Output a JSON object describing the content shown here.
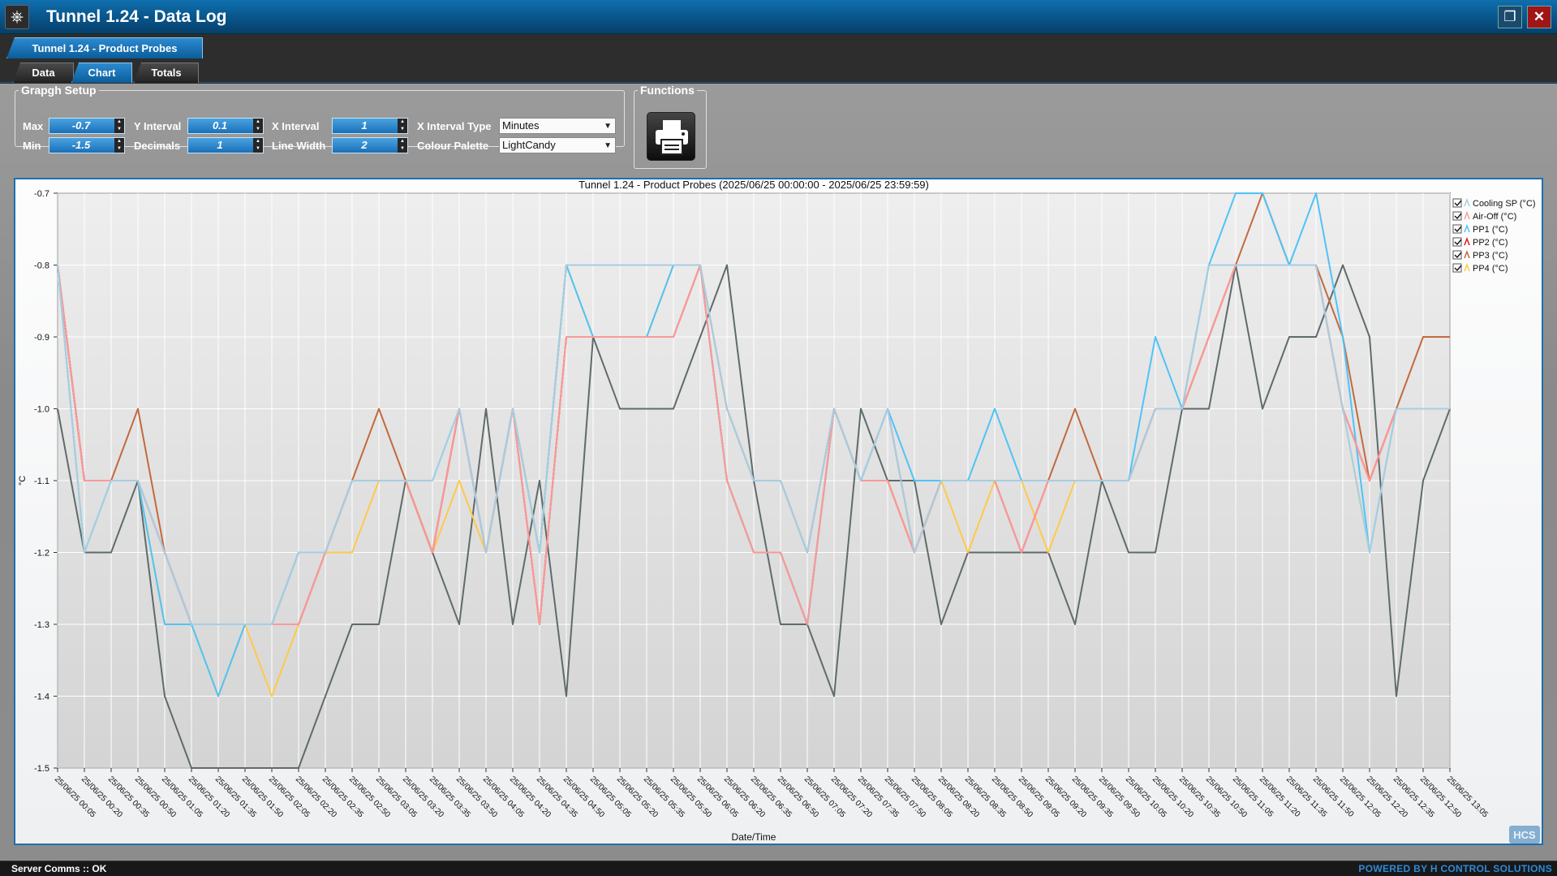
{
  "window": {
    "title": "Tunnel 1.24 - Data Log"
  },
  "top_tab": {
    "label": "Tunnel 1.24 - Product Probes"
  },
  "sub_tabs": [
    {
      "label": "Data"
    },
    {
      "label": "Chart"
    },
    {
      "label": "Totals"
    }
  ],
  "graph_setup": {
    "legend": "Grapgh Setup",
    "max_label": "Max",
    "max_value": "-0.7",
    "min_label": "Min",
    "min_value": "-1.5",
    "y_interval_label": "Y Interval",
    "y_interval_value": "0.1",
    "decimals_label": "Decimals",
    "decimals_value": "1",
    "x_interval_label": "X Interval",
    "x_interval_value": "1",
    "line_width_label": "Line Width",
    "line_width_value": "2",
    "x_interval_type_label": "X Interval Type",
    "x_interval_type_value": "Minutes",
    "colour_palette_label": "Colour Palette",
    "colour_palette_value": "LightCandy"
  },
  "functions": {
    "legend": "Functions",
    "print_icon": "printer-icon"
  },
  "status": {
    "text": "Server Comms :: OK",
    "powered": "POWERED BY H CONTROL SOLUTIONS"
  },
  "logo": {
    "text": "HCS"
  },
  "chart_data": {
    "type": "line",
    "title": "Tunnel 1.24 - Product Probes (2025/06/25 00:00:00 - 2025/06/25 23:59:59)",
    "xlabel": "Date/Time",
    "ylabel": "°C",
    "ylim": [
      -1.5,
      -0.7
    ],
    "yticks": [
      "-0.7",
      "-0.8",
      "-0.9",
      "-1.0",
      "-1.1",
      "-1.2",
      "-1.3",
      "-1.4",
      "-1.5"
    ],
    "grid": true,
    "legend_position": "top-right",
    "categories": [
      "25/06/25 00:05",
      "25/06/25 00:20",
      "25/06/25 00:35",
      "25/06/25 00:50",
      "25/06/25 01:05",
      "25/06/25 01:20",
      "25/06/25 01:35",
      "25/06/25 01:50",
      "25/06/25 02:05",
      "25/06/25 02:20",
      "25/06/25 02:35",
      "25/06/25 02:50",
      "25/06/25 03:05",
      "25/06/25 03:20",
      "25/06/25 03:35",
      "25/06/25 03:50",
      "25/06/25 04:05",
      "25/06/25 04:20",
      "25/06/25 04:35",
      "25/06/25 04:50",
      "25/06/25 05:05",
      "25/06/25 05:20",
      "25/06/25 05:35",
      "25/06/25 05:50",
      "25/06/25 06:05",
      "25/06/25 06:20",
      "25/06/25 06:35",
      "25/06/25 06:50",
      "25/06/25 07:05",
      "25/06/25 07:20",
      "25/06/25 07:35",
      "25/06/25 07:50",
      "25/06/25 08:05",
      "25/06/25 08:20",
      "25/06/25 08:35",
      "25/06/25 08:50",
      "25/06/25 09:05",
      "25/06/25 09:20",
      "25/06/25 09:35",
      "25/06/25 09:50",
      "25/06/25 10:05",
      "25/06/25 10:20",
      "25/06/25 10:35",
      "25/06/25 10:50",
      "25/06/25 11:05",
      "25/06/25 11:20",
      "25/06/25 11:35",
      "25/06/25 11:50",
      "25/06/25 12:05",
      "25/06/25 12:20",
      "25/06/25 12:35",
      "25/06/25 12:50",
      "25/06/25 13:05"
    ],
    "series": [
      {
        "name": "Cooling SP (°C)",
        "color": "#a6cee3",
        "values": [
          -0.8,
          -1.2,
          -1.1,
          -1.1,
          -1.2,
          -1.3,
          -1.3,
          -1.3,
          -1.3,
          -1.2,
          -1.2,
          -1.1,
          -1.1,
          -1.1,
          -1.1,
          -1.0,
          -1.2,
          -1.0,
          -1.2,
          -0.8,
          -0.8,
          -0.8,
          -0.8,
          -0.8,
          -0.8,
          -1.0,
          -1.1,
          -1.1,
          -1.2,
          -1.0,
          -1.1,
          -1.0,
          -1.2,
          -1.1,
          -1.1,
          -1.1,
          -1.1,
          -1.1,
          -1.1,
          -1.1,
          -1.1,
          -1.0,
          -1.0,
          -0.8,
          -0.8,
          -0.8,
          -0.8,
          -0.8,
          -1.0,
          -1.2,
          -1.0,
          -1.0,
          -1.0
        ]
      },
      {
        "name": "Air-Off (°C)",
        "color": "#fb9a99",
        "values": [
          -0.8,
          -1.1,
          -1.1,
          -1.1,
          -1.2,
          -1.3,
          -1.3,
          -1.3,
          -1.3,
          -1.3,
          -1.2,
          -1.1,
          -1.1,
          -1.1,
          -1.2,
          -1.0,
          -1.2,
          -1.0,
          -1.3,
          -0.9,
          -0.9,
          -0.9,
          -0.9,
          -0.9,
          -0.8,
          -1.1,
          -1.2,
          -1.2,
          -1.3,
          -1.0,
          -1.1,
          -1.1,
          -1.2,
          -1.1,
          -1.1,
          -1.1,
          -1.2,
          -1.1,
          -1.1,
          -1.1,
          -1.1,
          -1.0,
          -1.0,
          -0.9,
          -0.8,
          -0.8,
          -0.8,
          -0.8,
          -1.0,
          -1.1,
          -1.0,
          -1.0,
          -1.0
        ]
      },
      {
        "name": "PP1 (°C)",
        "color": "#4fc3f7",
        "values": [
          -0.8,
          -1.2,
          -1.1,
          -1.1,
          -1.3,
          -1.3,
          -1.4,
          -1.3,
          -1.3,
          -1.2,
          -1.2,
          -1.1,
          -1.1,
          -1.1,
          -1.1,
          -1.0,
          -1.2,
          -1.0,
          -1.2,
          -0.8,
          -0.9,
          -0.9,
          -0.9,
          -0.8,
          -0.8,
          -1.1,
          -1.2,
          -1.2,
          -1.3,
          -1.0,
          -1.1,
          -1.0,
          -1.1,
          -1.1,
          -1.1,
          -1.0,
          -1.1,
          -1.1,
          -1.1,
          -1.1,
          -1.1,
          -0.9,
          -1.0,
          -0.8,
          -0.7,
          -0.7,
          -0.8,
          -0.7,
          -0.9,
          -1.2,
          -1.0,
          -1.0,
          -1.0
        ]
      },
      {
        "name": "PP2 (°C)",
        "color": "#e31a1c",
        "values": [
          -0.8,
          -1.1,
          -1.1,
          -1.1,
          -1.2,
          -1.3,
          -1.3,
          -1.3,
          -1.3,
          -1.3,
          -1.2,
          -1.1,
          -1.1,
          -1.1,
          -1.2,
          -1.0,
          -1.2,
          -1.0,
          -1.3,
          -0.9,
          -0.9,
          -0.9,
          -0.9,
          -0.9,
          -0.8,
          -1.1,
          -1.2,
          -1.2,
          -1.3,
          -1.0,
          -1.1,
          -1.1,
          -1.2,
          -1.1,
          -1.1,
          -1.1,
          -1.2,
          -1.1,
          -1.1,
          -1.1,
          -1.1,
          -1.0,
          -1.0,
          -0.9,
          -0.8,
          -0.8,
          -0.8,
          -0.8,
          -1.0,
          -1.1,
          -1.0,
          -1.0,
          -1.0
        ]
      },
      {
        "name": "PP3 (°C)",
        "color": "#c26a3d",
        "values": [
          -0.8,
          -1.1,
          -1.1,
          -1.0,
          -1.2,
          -1.3,
          -1.3,
          -1.3,
          -1.3,
          -1.2,
          -1.2,
          -1.1,
          -1.0,
          -1.1,
          -1.2,
          -1.0,
          -1.2,
          -1.0,
          -1.2,
          -0.8,
          -0.8,
          -0.8,
          -0.8,
          -0.8,
          -0.8,
          -1.0,
          -1.1,
          -1.1,
          -1.2,
          -1.0,
          -1.1,
          -1.0,
          -1.2,
          -1.1,
          -1.1,
          -1.1,
          -1.1,
          -1.1,
          -1.0,
          -1.1,
          -1.1,
          -1.0,
          -1.0,
          -0.8,
          -0.8,
          -0.7,
          -0.8,
          -0.8,
          -0.9,
          -1.1,
          -1.0,
          -0.9,
          -0.9
        ]
      },
      {
        "name": "PP4 (°C)",
        "color": "#ffc94a",
        "values": [
          -0.8,
          -1.2,
          -1.1,
          -1.1,
          -1.3,
          -1.3,
          -1.4,
          -1.3,
          -1.4,
          -1.3,
          -1.2,
          -1.2,
          -1.1,
          -1.1,
          -1.2,
          -1.1,
          -1.2,
          -1.0,
          -1.2,
          -0.8,
          -0.9,
          -0.9,
          -0.9,
          -0.8,
          -0.8,
          -1.1,
          -1.2,
          -1.2,
          -1.3,
          -1.0,
          -1.1,
          -1.1,
          -1.2,
          -1.1,
          -1.2,
          -1.1,
          -1.1,
          -1.2,
          -1.1,
          -1.1,
          -1.1,
          -1.0,
          -1.0,
          -0.9,
          -0.8,
          -0.8,
          -0.8,
          -0.8,
          -1.0,
          -1.2,
          -1.0,
          -1.0,
          -1.0
        ]
      },
      {
        "name": "",
        "color": "#5f6b6b",
        "values": [
          -1.0,
          -1.2,
          -1.2,
          -1.1,
          -1.4,
          -1.5,
          -1.5,
          -1.5,
          -1.5,
          -1.5,
          -1.4,
          -1.3,
          -1.3,
          -1.1,
          -1.2,
          -1.3,
          -1.0,
          -1.3,
          -1.1,
          -1.4,
          -0.9,
          -1.0,
          -1.0,
          -1.0,
          -0.9,
          -0.8,
          -1.1,
          -1.3,
          -1.3,
          -1.4,
          -1.0,
          -1.1,
          -1.1,
          -1.3,
          -1.2,
          -1.2,
          -1.2,
          -1.2,
          -1.3,
          -1.1,
          -1.2,
          -1.2,
          -1.0,
          -1.0,
          -0.8,
          -1.0,
          -0.9,
          -0.9,
          -0.8,
          -0.9,
          -1.4,
          -1.1,
          -1.0
        ]
      }
    ]
  }
}
